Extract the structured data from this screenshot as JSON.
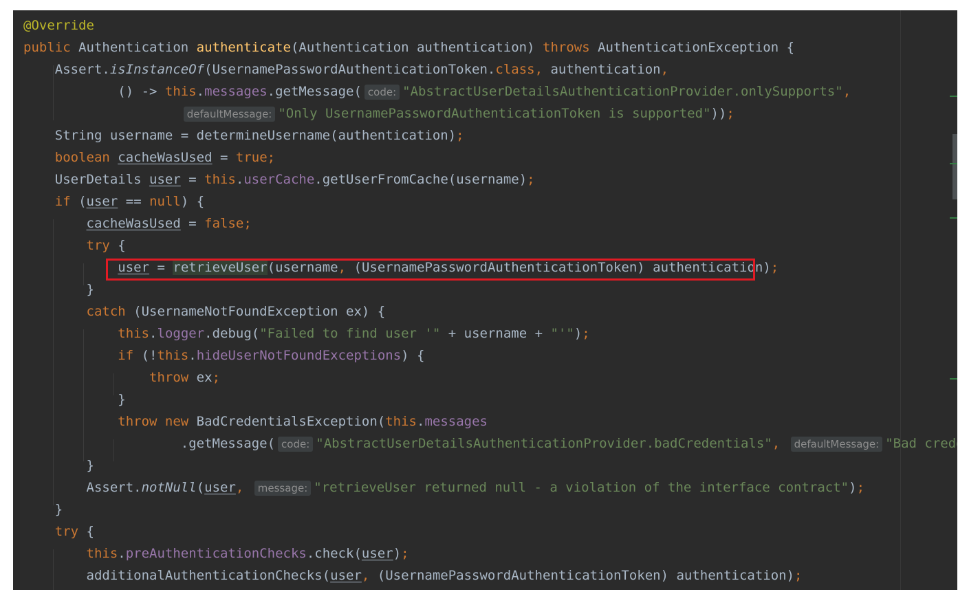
{
  "editor": {
    "lines": [
      {
        "segments": [
          {
            "t": "@Override",
            "c": "ann"
          }
        ]
      },
      {
        "segments": [
          {
            "t": "public ",
            "c": "kw"
          },
          {
            "t": "Authentication "
          },
          {
            "t": "authenticate",
            "c": "fn"
          },
          {
            "t": "(Authentication authentication) "
          },
          {
            "t": "throws ",
            "c": "kw"
          },
          {
            "t": "AuthenticationException {"
          }
        ]
      },
      {
        "segments": [
          {
            "t": "    Assert."
          },
          {
            "t": "isInstanceOf",
            "c": "it"
          },
          {
            "t": "(UsernamePasswordAuthenticationToken."
          },
          {
            "t": "class",
            "c": "kw"
          },
          {
            "t": ", ",
            "c": "kw"
          },
          {
            "t": "authentication"
          },
          {
            "t": ",",
            "c": "kw"
          }
        ]
      },
      {
        "segments": [
          {
            "t": "            () -> "
          },
          {
            "t": "this",
            "c": "kw"
          },
          {
            "t": "."
          },
          {
            "t": "messages",
            "c": "fld"
          },
          {
            "t": ".getMessage("
          },
          {
            "t": "code:",
            "c": "hint"
          },
          {
            "t": "\"AbstractUserDetailsAuthenticationProvider.onlySupports\"",
            "c": "str"
          },
          {
            "t": ",",
            "c": "kw"
          }
        ]
      },
      {
        "segments": [
          {
            "t": "                    "
          },
          {
            "t": "defaultMessage:",
            "c": "hint"
          },
          {
            "t": "\"Only UsernamePasswordAuthenticationToken is supported\"",
            "c": "str"
          },
          {
            "t": "))"
          },
          {
            "t": ";",
            "c": "kw"
          }
        ]
      },
      {
        "segments": [
          {
            "t": "    String username = determineUsername(authentication)"
          },
          {
            "t": ";",
            "c": "kw"
          }
        ]
      },
      {
        "segments": [
          {
            "t": "    "
          },
          {
            "t": "boolean ",
            "c": "kw"
          },
          {
            "t": "cacheWasUsed",
            "c": "u"
          },
          {
            "t": " = "
          },
          {
            "t": "true",
            "c": "kw"
          },
          {
            "t": ";",
            "c": "kw"
          }
        ]
      },
      {
        "segments": [
          {
            "t": "    UserDetails "
          },
          {
            "t": "user",
            "c": "u"
          },
          {
            "t": " = "
          },
          {
            "t": "this",
            "c": "kw"
          },
          {
            "t": "."
          },
          {
            "t": "userCache",
            "c": "fld"
          },
          {
            "t": ".getUserFromCache(username)"
          },
          {
            "t": ";",
            "c": "kw"
          }
        ]
      },
      {
        "segments": [
          {
            "t": "    "
          },
          {
            "t": "if ",
            "c": "kw"
          },
          {
            "t": "("
          },
          {
            "t": "user",
            "c": "u"
          },
          {
            "t": " == "
          },
          {
            "t": "null",
            "c": "kw"
          },
          {
            "t": ") {"
          }
        ]
      },
      {
        "segments": [
          {
            "t": "        "
          },
          {
            "t": "cacheWasUsed",
            "c": "u"
          },
          {
            "t": " = "
          },
          {
            "t": "false",
            "c": "kw"
          },
          {
            "t": ";",
            "c": "kw"
          }
        ]
      },
      {
        "segments": [
          {
            "t": "        "
          },
          {
            "t": "try ",
            "c": "kw"
          },
          {
            "t": "{"
          }
        ]
      },
      {
        "segments": [
          {
            "t": "            "
          },
          {
            "t": "user",
            "c": "u"
          },
          {
            "t": " = "
          },
          {
            "t": "retrieveUser",
            "c": "hl"
          },
          {
            "t": "(username"
          },
          {
            "t": ", ",
            "c": "kw"
          },
          {
            "t": "(UsernamePasswordAuthenticationToken) authentication)"
          },
          {
            "t": ";",
            "c": "kw"
          }
        ]
      },
      {
        "segments": [
          {
            "t": "        }"
          }
        ]
      },
      {
        "segments": [
          {
            "t": "        "
          },
          {
            "t": "catch ",
            "c": "kw"
          },
          {
            "t": "(UsernameNotFoundException ex) {"
          }
        ]
      },
      {
        "segments": [
          {
            "t": "            "
          },
          {
            "t": "this",
            "c": "kw"
          },
          {
            "t": "."
          },
          {
            "t": "logger",
            "c": "fld"
          },
          {
            "t": ".debug("
          },
          {
            "t": "\"Failed to find user '\"",
            "c": "str"
          },
          {
            "t": " + username + "
          },
          {
            "t": "\"'\"",
            "c": "str"
          },
          {
            "t": ")"
          },
          {
            "t": ";",
            "c": "kw"
          }
        ]
      },
      {
        "segments": [
          {
            "t": "            "
          },
          {
            "t": "if ",
            "c": "kw"
          },
          {
            "t": "(!"
          },
          {
            "t": "this",
            "c": "kw"
          },
          {
            "t": "."
          },
          {
            "t": "hideUserNotFoundExceptions",
            "c": "fld"
          },
          {
            "t": ") {"
          }
        ]
      },
      {
        "segments": [
          {
            "t": "                "
          },
          {
            "t": "throw ",
            "c": "kw"
          },
          {
            "t": "ex"
          },
          {
            "t": ";",
            "c": "kw"
          }
        ]
      },
      {
        "segments": [
          {
            "t": "            }"
          }
        ]
      },
      {
        "segments": [
          {
            "t": "            "
          },
          {
            "t": "throw new ",
            "c": "kw"
          },
          {
            "t": "BadCredentialsException("
          },
          {
            "t": "this",
            "c": "kw"
          },
          {
            "t": "."
          },
          {
            "t": "messages",
            "c": "fld"
          }
        ]
      },
      {
        "segments": [
          {
            "t": "                    .getMessage("
          },
          {
            "t": "code:",
            "c": "hint"
          },
          {
            "t": "\"AbstractUserDetailsAuthenticationProvider.badCredentials\"",
            "c": "str"
          },
          {
            "t": ", ",
            "c": "kw"
          },
          {
            "t": "defaultMessage:",
            "c": "hint"
          },
          {
            "t": "\"Bad credent",
            "c": "str"
          }
        ]
      },
      {
        "segments": [
          {
            "t": "        }"
          }
        ]
      },
      {
        "segments": [
          {
            "t": "        Assert."
          },
          {
            "t": "notNull",
            "c": "it"
          },
          {
            "t": "("
          },
          {
            "t": "user",
            "c": "u"
          },
          {
            "t": ", ",
            "c": "kw"
          },
          {
            "t": "message:",
            "c": "hint"
          },
          {
            "t": "\"retrieveUser returned null - a violation of the interface contract\"",
            "c": "str"
          },
          {
            "t": ")"
          },
          {
            "t": ";",
            "c": "kw"
          }
        ]
      },
      {
        "segments": [
          {
            "t": "    }"
          }
        ]
      },
      {
        "segments": [
          {
            "t": "    "
          },
          {
            "t": "try ",
            "c": "kw"
          },
          {
            "t": "{"
          }
        ]
      },
      {
        "segments": [
          {
            "t": "        "
          },
          {
            "t": "this",
            "c": "kw"
          },
          {
            "t": "."
          },
          {
            "t": "preAuthenticationChecks",
            "c": "fld"
          },
          {
            "t": ".check("
          },
          {
            "t": "user",
            "c": "u"
          },
          {
            "t": ")"
          },
          {
            "t": ";",
            "c": "kw"
          }
        ]
      },
      {
        "segments": [
          {
            "t": "        additionalAuthenticationChecks("
          },
          {
            "t": "user",
            "c": "u"
          },
          {
            "t": ", ",
            "c": "kw"
          },
          {
            "t": "(UsernamePasswordAuthenticationToken) authentication)"
          },
          {
            "t": ";",
            "c": "kw"
          }
        ]
      }
    ]
  },
  "highlighted_line_index": 11
}
